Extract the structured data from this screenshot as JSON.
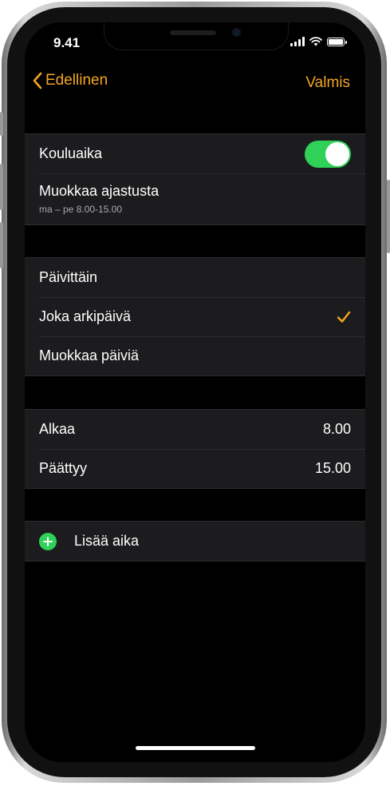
{
  "status_bar": {
    "time": "9.41"
  },
  "nav": {
    "back_label": "Edellinen",
    "done_label": "Valmis"
  },
  "schedule": {
    "title": "Kouluaika",
    "enabled": true,
    "edit_label": "Muokkaa ajastusta",
    "edit_summary": "ma – pe 8.00-15.00"
  },
  "repeat": {
    "options": [
      {
        "label": "Päivittäin",
        "selected": false
      },
      {
        "label": "Joka arkipäivä",
        "selected": true
      },
      {
        "label": "Muokkaa päiviä",
        "selected": false
      }
    ]
  },
  "times": {
    "start_label": "Alkaa",
    "start_value": "8.00",
    "end_label": "Päättyy",
    "end_value": "15.00"
  },
  "add_time": {
    "label": "Lisää aika"
  },
  "colors": {
    "accent": "#f5a623",
    "toggle_on": "#30d158",
    "background": "#000000",
    "cell": "#1c1c1e"
  }
}
